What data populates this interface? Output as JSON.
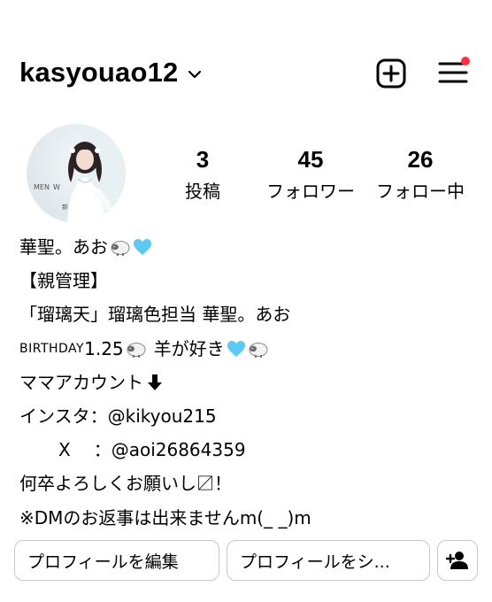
{
  "header": {
    "username": "kasyouao12",
    "create_icon": "plus-square-icon",
    "menu_icon": "hamburger-menu-icon",
    "chevron_icon": "chevron-down-icon",
    "notification_dot_color": "#ff3040"
  },
  "profile": {
    "avatar_icon": "profile-avatar",
    "stats": [
      {
        "count": "3",
        "label": "投稿"
      },
      {
        "count": "45",
        "label": "フォロワー"
      },
      {
        "count": "26",
        "label": "フォロー中"
      }
    ]
  },
  "bio": {
    "name": "華聖。あお",
    "line2": "【親管理】",
    "line3": "「瑠璃天」瑠璃色担当 華聖。あお",
    "birthday_prefix": "BIRTHDAY",
    "birthday_date": "1.25",
    "birthday_text": "羊が好き",
    "line5": "ママアカウント",
    "instagram_label": "インスタ：",
    "instagram_handle": "@kikyou215",
    "x_label": "X",
    "x_colon": "：",
    "x_handle": "@aoi26864359",
    "line8": "何卒よろしくお願いし〼！",
    "line9": "※DMのお返事は出来ませんm(_ _)m",
    "icons": {
      "sheep": "sheep-emoji-icon",
      "heart": "light-blue-heart-icon",
      "arrow": "down-arrow-icon"
    },
    "heart_color": "#5ec8f5"
  },
  "actions": {
    "edit_label": "プロフィールを編集",
    "share_label": "プロフィールをシ...",
    "suggest_icon": "add-person-icon"
  }
}
